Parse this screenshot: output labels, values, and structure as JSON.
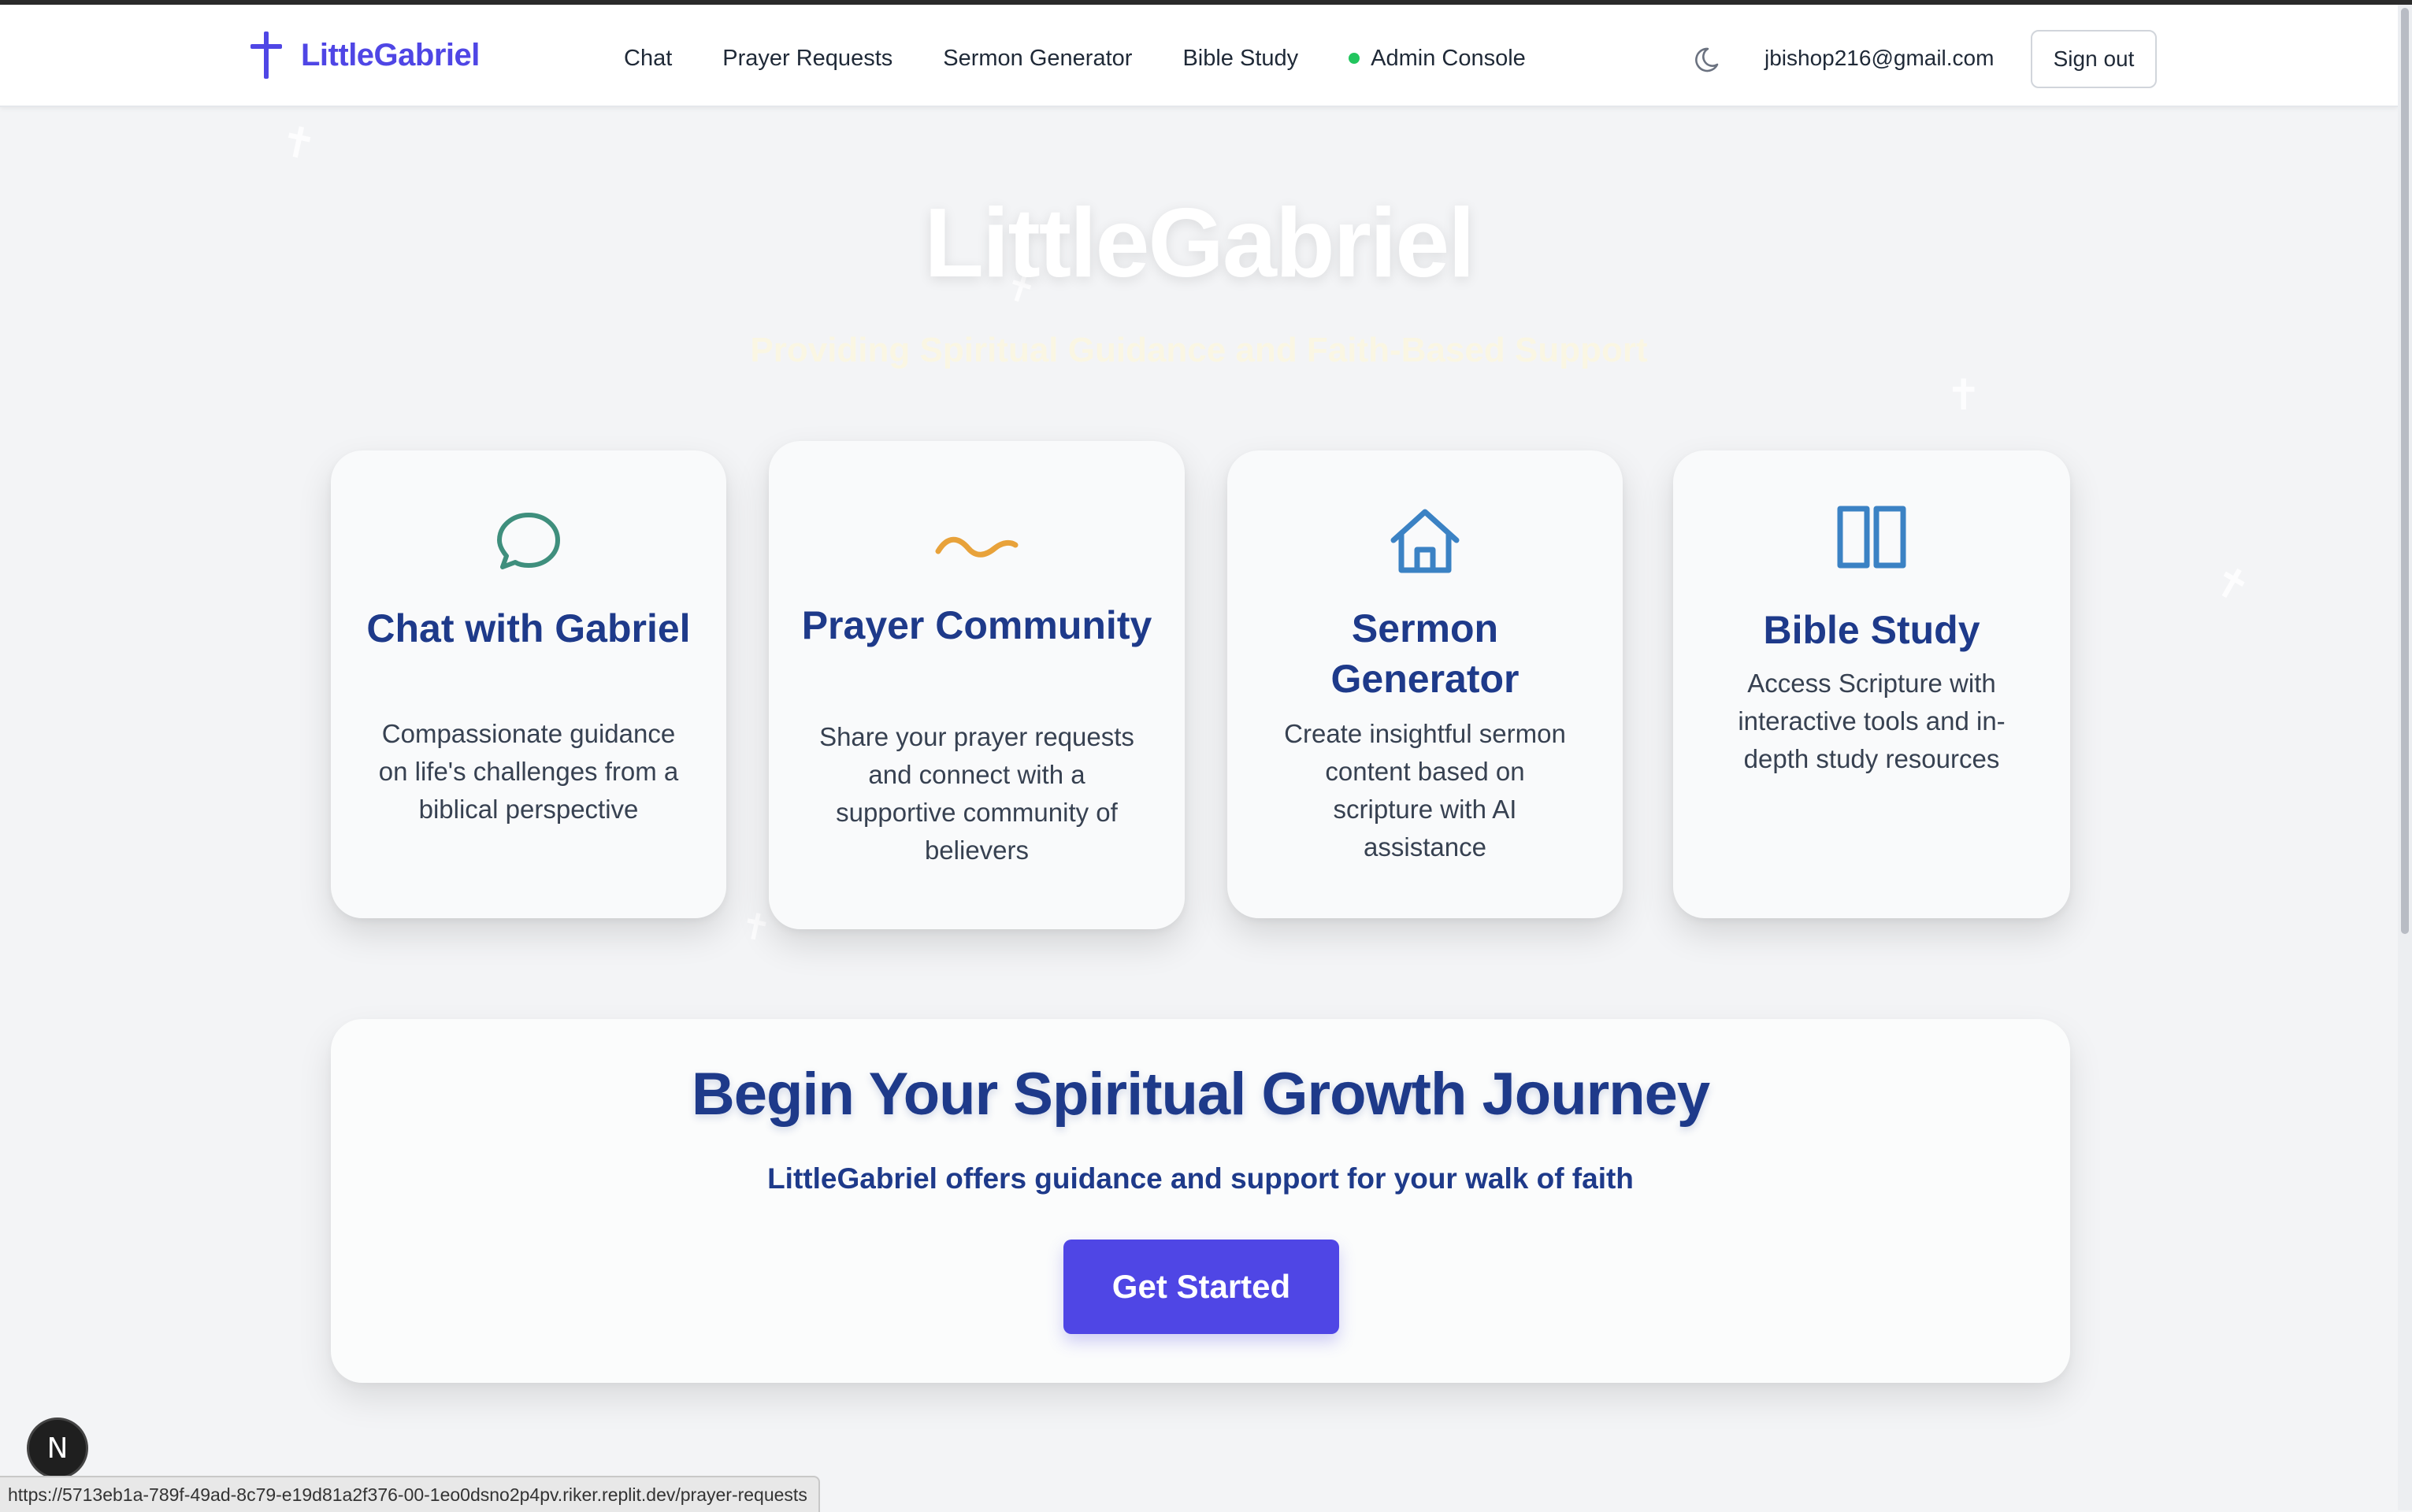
{
  "header": {
    "brand_name": "LittleGabriel",
    "brand_icon": "cross-icon",
    "nav": [
      {
        "label": "Chat"
      },
      {
        "label": "Prayer Requests"
      },
      {
        "label": "Sermon Generator"
      },
      {
        "label": "Bible Study"
      },
      {
        "label": "Admin Console",
        "status_dot": "#22c55e"
      }
    ],
    "theme_icon": "moon-icon",
    "user_email": "jbishop216@gmail.com",
    "signout_label": "Sign out"
  },
  "hero": {
    "title": "LittleGabriel",
    "subtitle": "Providing Spiritual Guidance and Faith-Based Support"
  },
  "features": [
    {
      "icon": "chat-bubble-icon",
      "icon_color": "#3f8f7d",
      "title": "Chat with Gabriel",
      "description": "Compassionate guidance on life's challenges from a biblical perspective"
    },
    {
      "icon": "wave-icon",
      "icon_color": "#e8a23a",
      "title": "Prayer Community",
      "description": "Share your prayer requests and connect with a supportive community of believers"
    },
    {
      "icon": "house-icon",
      "icon_color": "#3b82c4",
      "title": "Sermon Generator",
      "description": "Create insightful sermon content based on scripture with AI assistance"
    },
    {
      "icon": "book-open-icon",
      "icon_color": "#3b82c4",
      "title": "Bible Study",
      "description": "Access Scripture with interactive tools and in-depth study resources"
    }
  ],
  "cta": {
    "title": "Begin Your Spiritual Growth Journey",
    "subtitle": "LittleGabriel offers guidance and support for your walk of faith",
    "button_label": "Get Started"
  },
  "overlay": {
    "framework_badge": "N",
    "status_url": "https://5713eb1a-789f-49ad-8c79-e19d81a2f376-00-1eo0dsno2p4pv.riker.replit.dev/prayer-requests"
  },
  "colors": {
    "accent": "#4f46e5",
    "heading": "#1e3a8a",
    "background": "#f3f4f6"
  }
}
